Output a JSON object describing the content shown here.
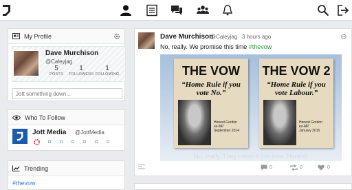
{
  "nav": {
    "icons": [
      "logo-icon",
      "profile-icon",
      "feed-icon",
      "messages-icon",
      "groups-icon",
      "notifications-icon",
      "search-icon",
      "logout-icon"
    ]
  },
  "profile_card": {
    "title": "My Profile",
    "name": "Dave Murchison",
    "handle": "@Caleyjag",
    "stats": [
      {
        "value": "5",
        "label": "POSTS"
      },
      {
        "value": "1",
        "label": "FOLLOWERS"
      },
      {
        "value": "1",
        "label": "FOLLOWING"
      }
    ],
    "input_placeholder": "Jott something down..."
  },
  "who_to_follow": {
    "title": "Who To Follow",
    "name": "Jott Media",
    "handle": "@JottMedia"
  },
  "trending": {
    "title": "Trending",
    "items": [
      "#thevow"
    ]
  },
  "post": {
    "author": "Dave Murchison",
    "handle": "@Caleyjag",
    "time": "3 hours ago",
    "text": "No, really. We promise this time",
    "hashtag": "#thevow",
    "image": {
      "left_title": "THE VOW",
      "left_subtitle": "“Home Rule if you vote No.”",
      "left_caption": [
        "Honest Gordon",
        "ex-MP",
        "September 2014"
      ],
      "right_title": "THE VOW 2",
      "right_subtitle": "“Home Rule if you vote Labour.”",
      "right_caption": [
        "Honest Gordon",
        "ex-MP",
        "January 2015"
      ],
      "footer_caption": "No, really. They mean it this time. Honest!"
    },
    "actions": {
      "replies": "0",
      "rejotts": "0",
      "likes": "0"
    }
  },
  "colors": {
    "accent_green": "#2aa33c",
    "link_blue": "#3a7bd5"
  }
}
